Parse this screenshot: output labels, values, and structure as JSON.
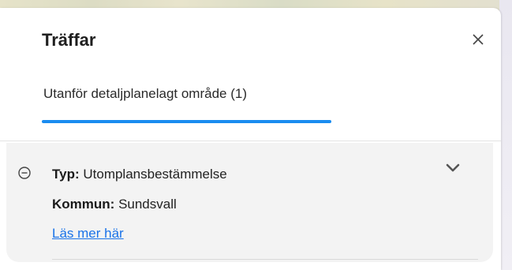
{
  "panel": {
    "title": "Träffar",
    "close_label": "×"
  },
  "tabs": [
    {
      "label": "Utanför detaljplanelagt område (1)",
      "active": true
    }
  ],
  "colors": {
    "accent": "#1a8cf0",
    "link": "#1a73e8",
    "card_bg": "#f3f3f3"
  },
  "result": {
    "type_label": "Typ:",
    "type_value": "Utomplansbestämmelse",
    "kommun_label": "Kommun:",
    "kommun_value": "Sundsvall",
    "link_text": "Läs mer här"
  },
  "icons": {
    "close": "close-icon",
    "collapse": "minus-circle-icon",
    "expand": "chevron-down-icon"
  }
}
